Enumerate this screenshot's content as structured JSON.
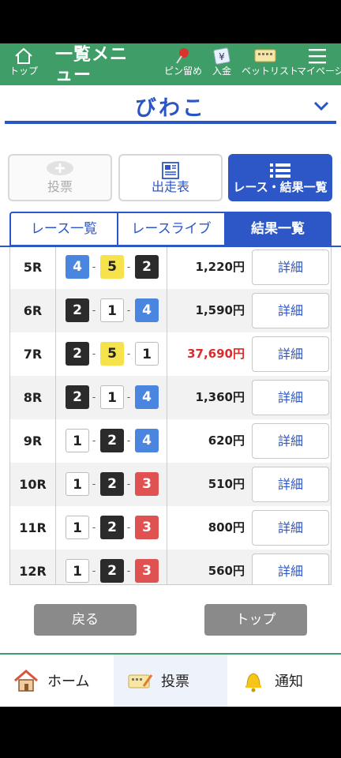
{
  "header": {
    "menu_title": "一覧メニュー",
    "nav": [
      {
        "label": "トップ",
        "icon": "home-icon"
      },
      {
        "label": "ピン留め",
        "icon": "pin-icon"
      },
      {
        "label": "入金",
        "icon": "yen-icon"
      },
      {
        "label": "ベットリスト",
        "icon": "ticket-icon"
      },
      {
        "label": "マイページ",
        "icon": "menu-icon"
      }
    ]
  },
  "venue": {
    "name": "びわこ"
  },
  "menu_buttons": [
    {
      "label": "投票",
      "state": "disabled"
    },
    {
      "label": "出走表",
      "state": "normal"
    },
    {
      "label": "レース・結果一覧",
      "state": "active"
    }
  ],
  "tabs": [
    "レース一覧",
    "レースライブ",
    "結果一覧"
  ],
  "active_tab": "結果一覧",
  "results": [
    {
      "race": "5R",
      "boats": [
        4,
        5,
        2
      ],
      "payout": "1,220円",
      "detail": "詳細"
    },
    {
      "race": "6R",
      "boats": [
        2,
        1,
        4
      ],
      "payout": "1,590円",
      "detail": "詳細"
    },
    {
      "race": "7R",
      "boats": [
        2,
        5,
        1
      ],
      "payout": "37,690円",
      "detail": "詳細",
      "highlight": true
    },
    {
      "race": "8R",
      "boats": [
        2,
        1,
        4
      ],
      "payout": "1,360円",
      "detail": "詳細"
    },
    {
      "race": "9R",
      "boats": [
        1,
        2,
        4
      ],
      "payout": "620円",
      "detail": "詳細"
    },
    {
      "race": "10R",
      "boats": [
        1,
        2,
        3
      ],
      "payout": "510円",
      "detail": "詳細"
    },
    {
      "race": "11R",
      "boats": [
        1,
        2,
        3
      ],
      "payout": "800円",
      "detail": "詳細"
    },
    {
      "race": "12R",
      "boats": [
        1,
        2,
        3
      ],
      "payout": "560円",
      "detail": "詳細"
    }
  ],
  "buttons": {
    "back": "戻る",
    "top": "トップ"
  },
  "bottom_nav": [
    {
      "label": "ホーム",
      "icon": "house-icon"
    },
    {
      "label": "投票",
      "icon": "ticket-icon",
      "active": true
    },
    {
      "label": "通知",
      "icon": "bell-icon"
    }
  ],
  "colors": {
    "header_green": "#3f9d68",
    "brand_blue": "#2d57c7",
    "highlight_red": "#e02a2a",
    "boat_1": "#ffffff",
    "boat_2": "#2b2b2b",
    "boat_3": "#e05252",
    "boat_4": "#4a86e0",
    "boat_5": "#f6e24a"
  }
}
